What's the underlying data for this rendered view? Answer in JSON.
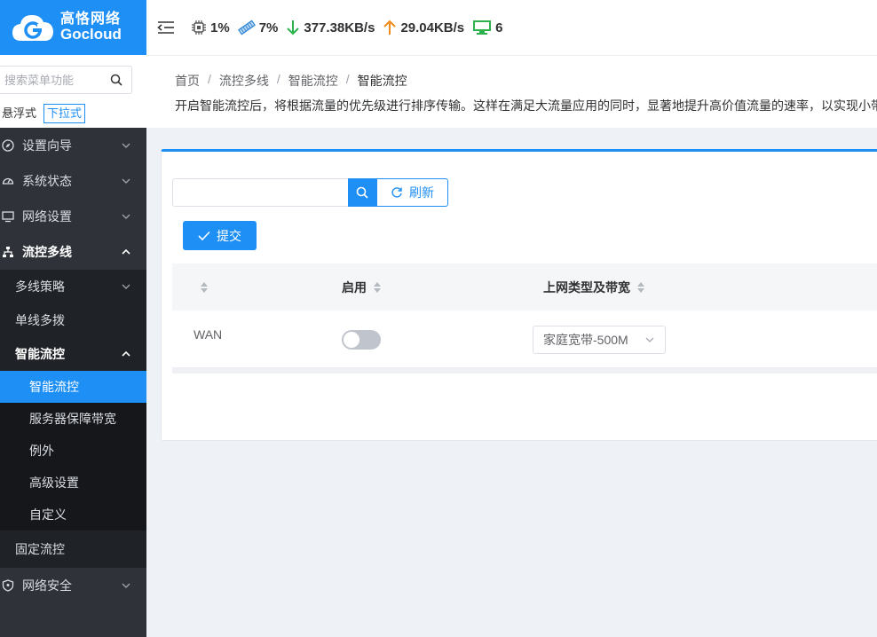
{
  "brand": {
    "cn": "高恪网络",
    "en": "Gocloud",
    "color": "#1e8ff5"
  },
  "sidebar": {
    "search_placeholder": "搜索菜单功能",
    "modes": [
      "悬浮式",
      "下拉式"
    ],
    "menu": [
      {
        "label": "设置向导",
        "icon": "compass-icon"
      },
      {
        "label": "系统状态",
        "icon": "dashboard-icon"
      },
      {
        "label": "网络设置",
        "icon": "monitor-icon"
      },
      {
        "label": "流控多线",
        "icon": "sitemap-icon"
      }
    ],
    "flow_sub": [
      "多线策略",
      "单线多拨",
      "智能流控"
    ],
    "smart_sub": [
      "智能流控",
      "服务器保障带宽",
      "例外",
      "高级设置",
      "自定义"
    ],
    "fixed": "固定流控",
    "security": "网络安全"
  },
  "topbar": {
    "cpu": "1%",
    "mem": "7%",
    "down": "377.38KB/s",
    "up": "29.04KB/s",
    "devices": "6"
  },
  "breadcrumb": [
    "首页",
    "流控多线",
    "智能流控",
    "智能流控"
  ],
  "breadcrumb_sep": "/",
  "description": "开启智能流控后，将根据流量的优先级进行排序传输。这样在满足大流量应用的同时，显著地提升高价值流量的速率，以实现小带",
  "toolbar": {
    "refresh": "刷新",
    "submit": "提交"
  },
  "table": {
    "headers": [
      "",
      "启用",
      "上网类型及带宽"
    ],
    "rows": [
      {
        "name": "WAN",
        "enabled": false,
        "bandwidth": "家庭宽带-500M"
      }
    ]
  }
}
